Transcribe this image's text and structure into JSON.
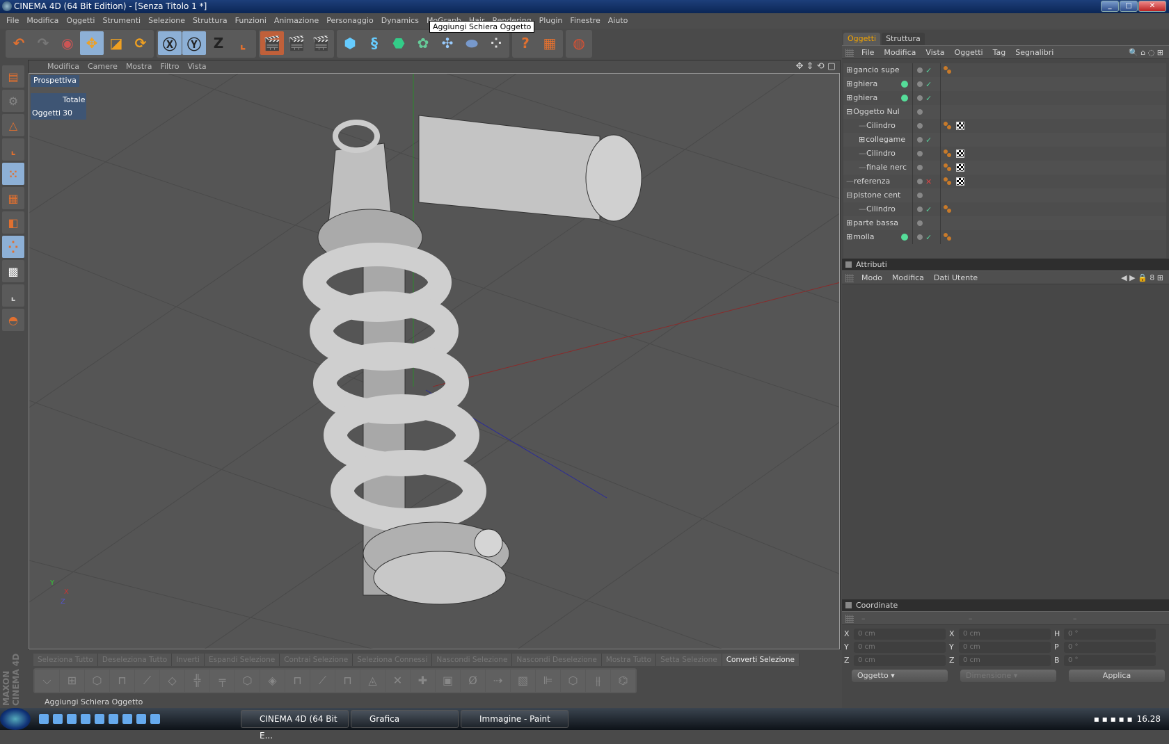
{
  "window": {
    "title": "CINEMA 4D (64 Bit Edition) - [Senza Titolo 1 *]"
  },
  "menu": [
    "File",
    "Modifica",
    "Oggetti",
    "Strumenti",
    "Selezione",
    "Struttura",
    "Funzioni",
    "Animazione",
    "Personaggio",
    "Dynamics",
    "MoGraph",
    "Hair",
    "Rendering",
    "Plugin",
    "Finestre",
    "Aiuto"
  ],
  "tooltip": "Aggiungi Schiera Oggetto",
  "viewport": {
    "menu": [
      "Modifica",
      "Camere",
      "Mostra",
      "Filtro",
      "Vista"
    ],
    "view_name": "Prospettiva",
    "stats": {
      "header": "Totale",
      "label": "Oggetti",
      "value": "30"
    }
  },
  "object_manager": {
    "tabs": [
      "Oggetti",
      "Struttura"
    ],
    "menu": [
      "File",
      "Modifica",
      "Vista",
      "Oggetti",
      "Tag",
      "Segnalibri"
    ],
    "objects": [
      {
        "name": "gancio supe",
        "indent": 0,
        "expander": "+",
        "check": "ok",
        "tags": [
          "phong"
        ]
      },
      {
        "name": "ghiera",
        "indent": 0,
        "expander": "+",
        "check": "ok",
        "tags": [],
        "icon": "sphere"
      },
      {
        "name": "ghiera",
        "indent": 0,
        "expander": "+",
        "check": "ok",
        "tags": [],
        "icon": "sphere"
      },
      {
        "name": "Oggetto Nul",
        "indent": 0,
        "expander": "-",
        "check": "",
        "tags": []
      },
      {
        "name": "Cilindro",
        "indent": 1,
        "expander": "",
        "check": "",
        "tags": [
          "phong",
          "texture"
        ]
      },
      {
        "name": "collegame",
        "indent": 1,
        "expander": "+",
        "check": "ok",
        "tags": []
      },
      {
        "name": "Cilindro",
        "indent": 1,
        "expander": "",
        "check": "",
        "tags": [
          "phong",
          "texture"
        ]
      },
      {
        "name": "finale nerc",
        "indent": 1,
        "expander": "",
        "check": "",
        "tags": [
          "phong",
          "texture"
        ]
      },
      {
        "name": "referenza",
        "indent": 0,
        "expander": "",
        "check": "x",
        "tags": [
          "phong",
          "display"
        ]
      },
      {
        "name": "pistone cent",
        "indent": 0,
        "expander": "-",
        "check": "",
        "tags": []
      },
      {
        "name": "Cilindro",
        "indent": 1,
        "expander": "",
        "check": "ok",
        "tags": [
          "phong"
        ]
      },
      {
        "name": "parte bassa",
        "indent": 0,
        "expander": "+",
        "check": "",
        "tags": []
      },
      {
        "name": "molla",
        "indent": 0,
        "expander": "+",
        "check": "ok",
        "tags": [
          "phong"
        ],
        "icon": "spring"
      }
    ]
  },
  "attributes": {
    "title": "Attributi",
    "menu": [
      "Modo",
      "Modifica",
      "Dati Utente"
    ]
  },
  "coordinates": {
    "title": "Coordinate",
    "headers": [
      "–",
      "–",
      "–"
    ],
    "rows": [
      [
        "X",
        "0 cm",
        "X",
        "0 cm",
        "H",
        "0 °"
      ],
      [
        "Y",
        "0 cm",
        "Y",
        "0 cm",
        "P",
        "0 °"
      ],
      [
        "Z",
        "0 cm",
        "Z",
        "0 cm",
        "B",
        "0 °"
      ]
    ],
    "mode_select": "Oggetto",
    "size_select": "Dimensione",
    "apply": "Applica"
  },
  "selection_toolbar": [
    "Seleziona Tutto",
    "Deseleziona Tutto",
    "Inverti",
    "Espandi Selezione",
    "Contrai Selezione",
    "Seleziona Connessi",
    "Nascondi Selezione",
    "Nascondi Deselezione",
    "Mostra Tutto",
    "Setta Selezione",
    "Converti Selezione"
  ],
  "status": "Aggiungi Schiera Oggetto",
  "brand": "MAXON CINEMA 4D",
  "taskbar": {
    "tasks": [
      "CINEMA 4D (64 Bit E...",
      "Grafica",
      "Immagine - Paint"
    ],
    "clock": "16.28"
  }
}
